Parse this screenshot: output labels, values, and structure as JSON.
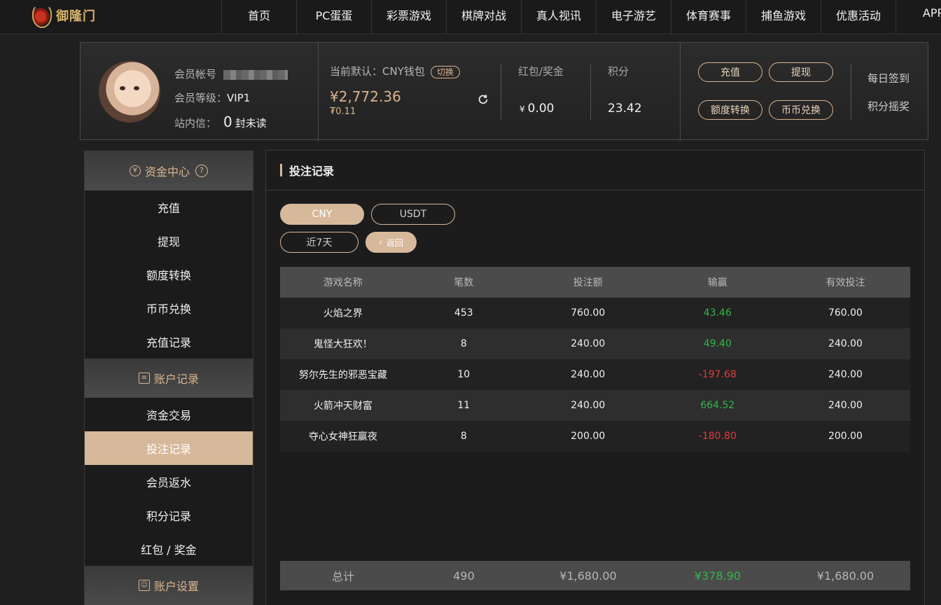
{
  "brand": {
    "logo_text": "御隆门"
  },
  "nav": [
    {
      "label": "首页"
    },
    {
      "label": "PC蛋蛋"
    },
    {
      "label": "彩票游戏"
    },
    {
      "label": "棋牌对战"
    },
    {
      "label": "真人视讯"
    },
    {
      "label": "电子游艺"
    },
    {
      "label": "体育赛事"
    },
    {
      "label": "捕鱼游戏"
    },
    {
      "label": "优惠活动"
    },
    {
      "label": "APP"
    }
  ],
  "member": {
    "account_label": "会员帐号",
    "level_label": "会员等级：",
    "level_value": "VIP1",
    "inbox_label": "站内信：",
    "inbox_count": "0",
    "inbox_suffix": "封未读"
  },
  "wallet": {
    "label": "当前默认：CNY钱包",
    "switch_label": "切换",
    "balance": "¥2,772.36",
    "sub_balance": "₮0.11"
  },
  "stats": {
    "bonus_label": "红包/奖金",
    "bonus_currency": "¥",
    "bonus_value": "0.00",
    "points_label": "积分",
    "points_value": "23.42"
  },
  "actions": {
    "recharge": "充值",
    "withdraw": "提现",
    "transfer": "额度转换",
    "exchange": "币币兑换",
    "daily_signin": "每日签到",
    "points_lottery": "积分摇奖"
  },
  "sidebar": {
    "group_funds": "资金中心",
    "funds_items": [
      {
        "label": "充值"
      },
      {
        "label": "提现"
      },
      {
        "label": "额度转换"
      },
      {
        "label": "币币兑换"
      },
      {
        "label": "充值记录"
      }
    ],
    "group_records": "账户记录",
    "records_items": [
      {
        "label": "资金交易"
      },
      {
        "label": "投注记录"
      },
      {
        "label": "会员返水"
      },
      {
        "label": "积分记录"
      },
      {
        "label": "红包 / 奖金"
      }
    ],
    "group_settings": "账户设置"
  },
  "main": {
    "title": "投注记录",
    "currency_tabs": [
      {
        "label": "CNY"
      },
      {
        "label": "USDT"
      }
    ],
    "range_label": "近7天",
    "back_label": "返回",
    "columns": [
      "游戏名称",
      "笔数",
      "投注额",
      "输赢",
      "有效投注"
    ],
    "rows": [
      {
        "game": "火焰之界",
        "count": "453",
        "bet": "760.00",
        "winloss": "43.46",
        "valid": "760.00"
      },
      {
        "game": "鬼怪大狂欢！",
        "count": "8",
        "bet": "240.00",
        "winloss": "49.40",
        "valid": "240.00"
      },
      {
        "game": "努尔先生的邪恶宝藏",
        "count": "10",
        "bet": "240.00",
        "winloss": "-197.68",
        "valid": "240.00"
      },
      {
        "game": "火箭冲天财富",
        "count": "11",
        "bet": "240.00",
        "winloss": "664.52",
        "valid": "240.00"
      },
      {
        "game": "夺心女神狂赢夜",
        "count": "8",
        "bet": "200.00",
        "winloss": "-180.80",
        "valid": "200.00"
      }
    ],
    "totals": {
      "label": "总计",
      "count": "490",
      "bet": "¥1,680.00",
      "winloss": "¥378.90",
      "valid": "¥1,680.00"
    }
  },
  "colors": {
    "accent": "#d6b89a",
    "positive": "#33b54a",
    "negative": "#e03b3b"
  }
}
